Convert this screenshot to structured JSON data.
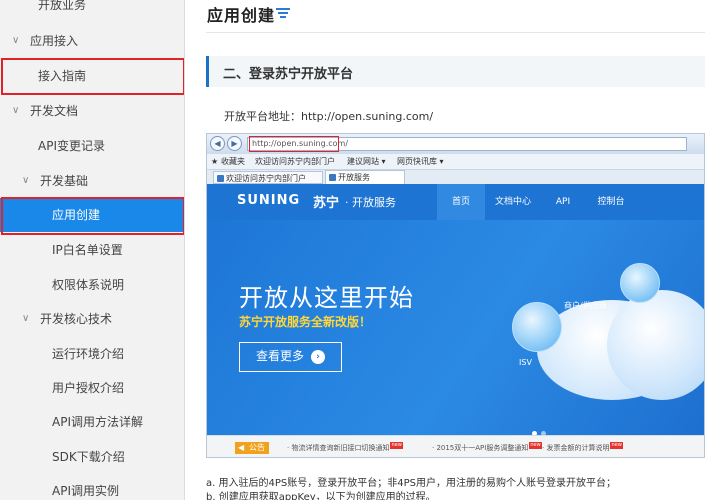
{
  "sidebar": {
    "items": [
      {
        "label": "开放业务",
        "arrow": ""
      },
      {
        "label": "应用接入",
        "arrow": "∨"
      },
      {
        "label": "接入指南",
        "arrow": ""
      },
      {
        "label": "开发文档",
        "arrow": "∨"
      },
      {
        "label": "API变更记录",
        "arrow": ""
      },
      {
        "label": "开发基础",
        "arrow": "∨"
      },
      {
        "label": "应用创建",
        "arrow": ""
      },
      {
        "label": "IP白名单设置",
        "arrow": ""
      },
      {
        "label": "权限体系说明",
        "arrow": ""
      },
      {
        "label": "开发核心技术",
        "arrow": "∨"
      },
      {
        "label": "运行环境介绍",
        "arrow": ""
      },
      {
        "label": "用户授权介绍",
        "arrow": ""
      },
      {
        "label": "API调用方法详解",
        "arrow": ""
      },
      {
        "label": "SDK下载介绍",
        "arrow": ""
      },
      {
        "label": "API调用实例",
        "arrow": ""
      }
    ],
    "active_label": "应用创建",
    "colors": {
      "active_bg": "#1a88e8",
      "highlight": "#e0222b"
    }
  },
  "main": {
    "title": "应用创建",
    "title_icon": "list-filter-icon",
    "section_heading": "二、登录苏宁开放平台",
    "address_line": "开放平台地址：http://open.suning.com/",
    "steps": [
      "a. 用入驻后的4PS账号，登录开放平台；非4PS用户，用注册的易购个人账号登录开放平台；",
      "b. 创建应用获取appKey，以下为创建应用的过程。"
    ]
  },
  "screenshot": {
    "url": "http://open.suning.com/",
    "fav_label": "收藏夹",
    "fav_links": [
      "欢迎访问苏宁内部门户",
      "建议网站 ▾",
      "网页快讯库 ▾"
    ],
    "tabs": [
      "欢迎访问苏宁内部门户",
      "开放服务"
    ],
    "brand": "SUNING",
    "brand_cn": "苏宁",
    "brand_sub": "· 开放服务",
    "nav": [
      "首页",
      "文档中心",
      "API",
      "控制台"
    ],
    "nav_active": "首页",
    "hero_title": "开放从这里开始",
    "hero_subtitle": "苏宁开放服务全新改版！",
    "hero_button": "查看更多",
    "hero_tags": [
      "商户/供应商",
      "ISV"
    ],
    "notice_label": "公告",
    "notices": [
      "· 物流详情查询新旧接口切换通知",
      "· 2015双十一API服务调整通知",
      "· 发票金额的计算说明"
    ],
    "hot_tag": "new"
  }
}
